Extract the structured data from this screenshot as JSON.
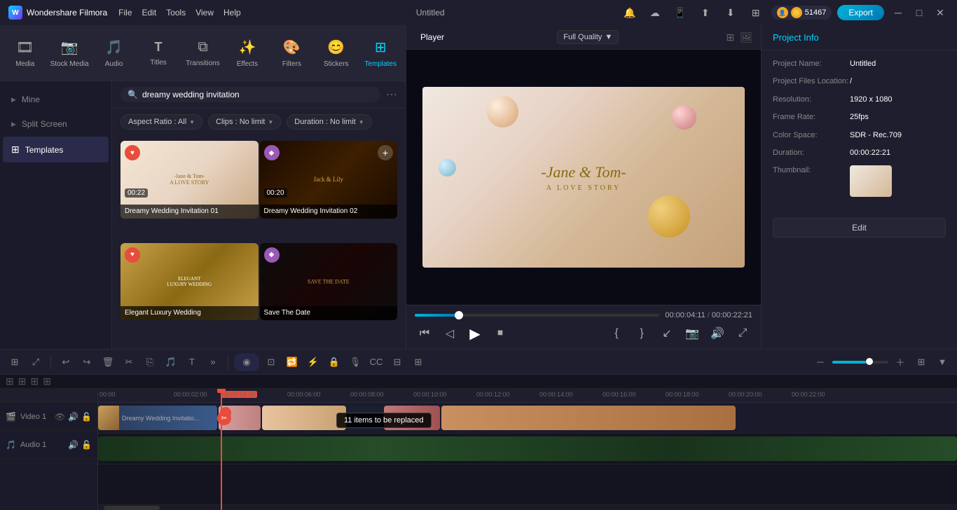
{
  "app": {
    "name": "Wondershare Filmora",
    "title": "Untitled"
  },
  "menu": {
    "items": [
      "File",
      "Edit",
      "Tools",
      "View",
      "Help"
    ]
  },
  "window_controls": [
    "─",
    "□",
    "✕"
  ],
  "coins": "51467",
  "export_label": "Export",
  "toolbar": {
    "items": [
      {
        "id": "media",
        "label": "Media",
        "icon": "🎞"
      },
      {
        "id": "stock",
        "label": "Stock Media",
        "icon": "📷"
      },
      {
        "id": "audio",
        "label": "Audio",
        "icon": "🎵"
      },
      {
        "id": "titles",
        "label": "Titles",
        "icon": "T"
      },
      {
        "id": "transitions",
        "label": "Transitions",
        "icon": "⧉"
      },
      {
        "id": "effects",
        "label": "Effects",
        "icon": "✨"
      },
      {
        "id": "filters",
        "label": "Filters",
        "icon": "🎨"
      },
      {
        "id": "stickers",
        "label": "Stickers",
        "icon": "😊"
      },
      {
        "id": "templates",
        "label": "Templates",
        "icon": "⊞",
        "active": true
      }
    ]
  },
  "sidebar": {
    "items": [
      {
        "id": "mine",
        "label": "Mine",
        "has_arrow": true
      },
      {
        "id": "split_screen",
        "label": "Split Screen",
        "has_arrow": true
      },
      {
        "id": "templates",
        "label": "Templates",
        "active": true,
        "icon": "⊞"
      }
    ]
  },
  "search": {
    "placeholder": "dreamy wedding invitation",
    "value": "dreamy wedding invitation"
  },
  "filters": {
    "aspect_ratio": "Aspect Ratio : All",
    "clips": "Clips : No limit",
    "duration": "Duration : No limit"
  },
  "templates": [
    {
      "id": "wedding-01",
      "name": "Dreamy Wedding Invitation 01",
      "duration": "00:22",
      "badge": "heart",
      "thumb_style": "thumb-1"
    },
    {
      "id": "wedding-02",
      "name": "Dreamy Wedding Invitation 02",
      "duration": "00:20",
      "badge": "diamond",
      "thumb_style": "thumb-2",
      "show_add": true
    },
    {
      "id": "luxury",
      "name": "Elegant Luxury Wedding",
      "duration": "",
      "badge": "heart",
      "thumb_style": "thumb-3"
    },
    {
      "id": "save-date",
      "name": "Save The Date",
      "duration": "",
      "badge": "diamond",
      "thumb_style": "thumb-4"
    }
  ],
  "player": {
    "tab_label": "Player",
    "quality": "Full Quality",
    "preview_couple": "-Jane & Tom-",
    "preview_subtitle": "A LOVE STORY",
    "current_time": "00:00:04:11",
    "total_time": "00:00:22:21",
    "progress_percent": 18
  },
  "project_info": {
    "title": "Project Info",
    "name_label": "Project Name:",
    "name_value": "Untitled",
    "files_label": "Project Files Location:",
    "files_value": "/",
    "resolution_label": "Resolution:",
    "resolution_value": "1920 x 1080",
    "framerate_label": "Frame Rate:",
    "framerate_value": "25fps",
    "colorspace_label": "Color Space:",
    "colorspace_value": "SDR - Rec.709",
    "duration_label": "Duration:",
    "duration_value": "00:00:22:21",
    "thumbnail_label": "Thumbnail:",
    "edit_label": "Edit"
  },
  "timeline": {
    "ruler_marks": [
      "00:00",
      "00:00:02:00",
      "00:00:04:00",
      "00:00:06:00",
      "00:00:08:00",
      "00:00:10:00",
      "00:00:12:00",
      "00:00:14:00",
      "00:00:16:00",
      "00:00:18:00",
      "00:00:20:00",
      "00:00:22:00"
    ],
    "tracks": [
      {
        "id": "video1",
        "label": "Video 1",
        "type": "video"
      },
      {
        "id": "audio1",
        "label": "Audio 1",
        "type": "audio"
      }
    ],
    "tooltip": "11 items to be replaced",
    "clip_label": "Dreamy Wedding Invitatio..."
  },
  "timeline_toolbar": {
    "buttons": [
      "⊞",
      "⤢",
      "✂",
      "⎘",
      "⌫",
      "✂",
      "⊔",
      "🎵",
      "T",
      "»"
    ]
  }
}
